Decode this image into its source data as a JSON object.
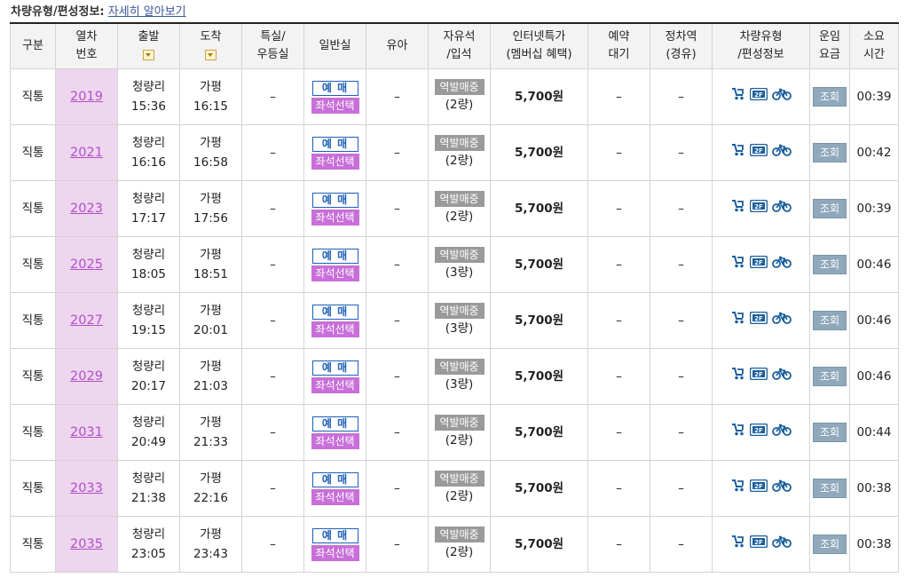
{
  "note": {
    "label": "차량유형/편성정보:",
    "link": "자세히 알아보기"
  },
  "headers": {
    "gubun": "구분",
    "trainno": [
      "열차",
      "번호"
    ],
    "depart": "출발",
    "arrive": "도착",
    "special": [
      "특실/",
      "우등실"
    ],
    "general": "일반실",
    "infant": "유아",
    "free": [
      "자유석",
      "/입석"
    ],
    "internet": [
      "인터넷특가",
      "(멤버십 혜택)"
    ],
    "waitlist": [
      "예약",
      "대기"
    ],
    "transfer": [
      "정차역",
      "(경유)"
    ],
    "vehicle": [
      "차량유형",
      "/편성정보"
    ],
    "fare": [
      "운임",
      "요금"
    ],
    "duration": [
      "소요",
      "시간"
    ]
  },
  "labels": {
    "reserve": "예 매",
    "seat_select": "좌석선택",
    "station_sale": "역발매중",
    "inquiry": "조회",
    "dash": "–"
  },
  "icon_names": [
    "stroller-icon",
    "2f-icon",
    "bicycle-icon"
  ],
  "rows": [
    {
      "type": "직통",
      "no": "2019",
      "from": "청량리",
      "dep": "15:36",
      "to": "가평",
      "arr": "16:15",
      "cars": "(2량)",
      "price": "5,700원",
      "dur": "00:39"
    },
    {
      "type": "직통",
      "no": "2021",
      "from": "청량리",
      "dep": "16:16",
      "to": "가평",
      "arr": "16:58",
      "cars": "(2량)",
      "price": "5,700원",
      "dur": "00:42"
    },
    {
      "type": "직통",
      "no": "2023",
      "from": "청량리",
      "dep": "17:17",
      "to": "가평",
      "arr": "17:56",
      "cars": "(2량)",
      "price": "5,700원",
      "dur": "00:39"
    },
    {
      "type": "직통",
      "no": "2025",
      "from": "청량리",
      "dep": "18:05",
      "to": "가평",
      "arr": "18:51",
      "cars": "(3량)",
      "price": "5,700원",
      "dur": "00:46"
    },
    {
      "type": "직통",
      "no": "2027",
      "from": "청량리",
      "dep": "19:15",
      "to": "가평",
      "arr": "20:01",
      "cars": "(3량)",
      "price": "5,700원",
      "dur": "00:46"
    },
    {
      "type": "직통",
      "no": "2029",
      "from": "청량리",
      "dep": "20:17",
      "to": "가평",
      "arr": "21:03",
      "cars": "(3량)",
      "price": "5,700원",
      "dur": "00:46"
    },
    {
      "type": "직통",
      "no": "2031",
      "from": "청량리",
      "dep": "20:49",
      "to": "가평",
      "arr": "21:33",
      "cars": "(2량)",
      "price": "5,700원",
      "dur": "00:44"
    },
    {
      "type": "직통",
      "no": "2033",
      "from": "청량리",
      "dep": "21:38",
      "to": "가평",
      "arr": "22:16",
      "cars": "(2량)",
      "price": "5,700원",
      "dur": "00:38"
    },
    {
      "type": "직통",
      "no": "2035",
      "from": "청량리",
      "dep": "23:05",
      "to": "가평",
      "arr": "23:43",
      "cars": "(2량)",
      "price": "5,700원",
      "dur": "00:38"
    }
  ]
}
